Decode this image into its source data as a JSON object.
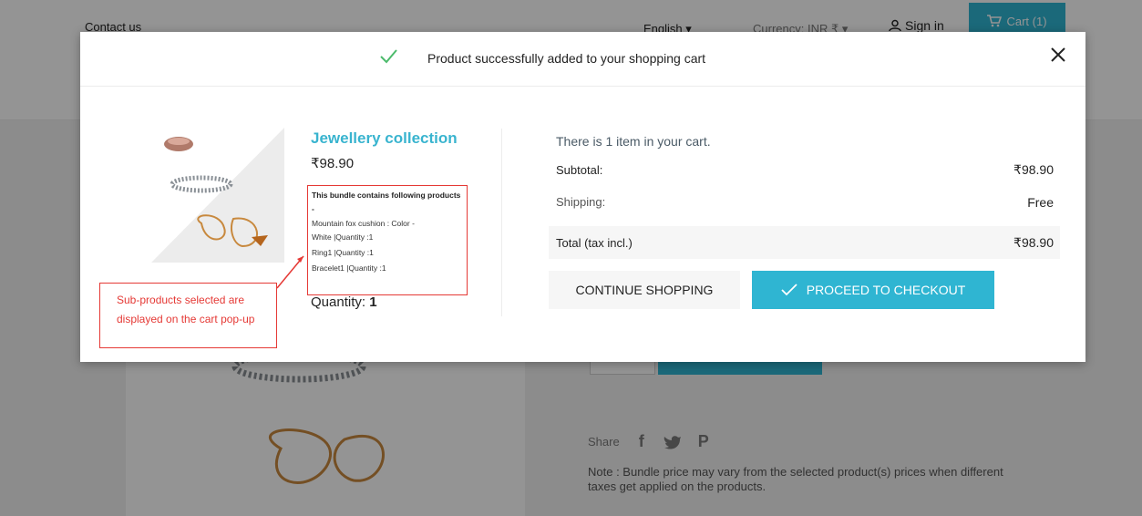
{
  "topbar": {
    "contact": "Contact us",
    "language": "English ▾",
    "currency": "Currency: INR ₹ ▾",
    "signin": "Sign in",
    "cart": "Cart (1)"
  },
  "page": {
    "share_label": "Share",
    "social": [
      "f",
      "•",
      "P"
    ],
    "note": "Note : Bundle price may vary from the selected product(s) prices when different taxes get applied on the products."
  },
  "modal": {
    "title": "Product successfully added to your shopping cart",
    "product": {
      "name": "Jewellery collection",
      "price": "₹98.90",
      "bundle_heading": "This bundle contains following products -",
      "bundle_lines": [
        "Mountain fox cushion : Color -",
        "White |Quantity :1",
        "Ring1 |Quantity :1",
        "Bracelet1 |Quantity :1"
      ],
      "quantity_label": "Quantity:",
      "quantity_value": "1"
    },
    "cart": {
      "count_text": "There is 1 item in your cart.",
      "subtotal_label": "Subtotal:",
      "subtotal_value": "₹98.90",
      "shipping_label": "Shipping:",
      "shipping_value": "Free",
      "total_label": "Total (tax incl.)",
      "total_value": "₹98.90"
    },
    "buttons": {
      "continue": "CONTINUE SHOPPING",
      "checkout": "PROCEED TO CHECKOUT"
    }
  },
  "annotation": {
    "text": "Sub-products selected are displayed on the cart pop-up"
  },
  "colors": {
    "accent": "#2fb5d2",
    "product_name": "#39b4cf",
    "annotation": "#e53935"
  }
}
